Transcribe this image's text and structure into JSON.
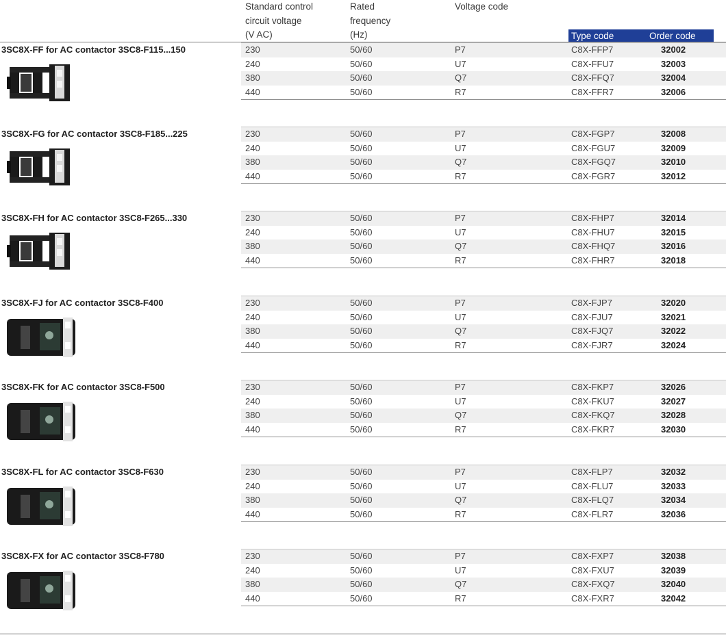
{
  "header": {
    "col_voltage_lines": [
      "Standard control",
      "circuit voltage",
      "(V AC)"
    ],
    "col_frequency_lines": [
      "Rated",
      "frequency",
      "(Hz)"
    ],
    "col_voltage_code": "Voltage code",
    "col_type_code": "Type code",
    "col_order_code": "Order code"
  },
  "colors": {
    "header_band": "#1f3f97",
    "row_shade": "#efefef"
  },
  "groups": [
    {
      "title": "3SC8X-FF for AC contactor 3SC8-F115...150",
      "image_icon": "contactor-coil-small-icon",
      "rows": [
        {
          "voltage": "230",
          "frequency": "50/60",
          "code": "P7",
          "type": "C8X-FFP7",
          "order": "32002"
        },
        {
          "voltage": "240",
          "frequency": "50/60",
          "code": "U7",
          "type": "C8X-FFU7",
          "order": "32003"
        },
        {
          "voltage": "380",
          "frequency": "50/60",
          "code": "Q7",
          "type": "C8X-FFQ7",
          "order": "32004"
        },
        {
          "voltage": "440",
          "frequency": "50/60",
          "code": "R7",
          "type": "C8X-FFR7",
          "order": "32006"
        }
      ]
    },
    {
      "title": "3SC8X-FG for AC contactor 3SC8-F185...225",
      "image_icon": "contactor-coil-small-icon",
      "rows": [
        {
          "voltage": "230",
          "frequency": "50/60",
          "code": "P7",
          "type": "C8X-FGP7",
          "order": "32008"
        },
        {
          "voltage": "240",
          "frequency": "50/60",
          "code": "U7",
          "type": "C8X-FGU7",
          "order": "32009"
        },
        {
          "voltage": "380",
          "frequency": "50/60",
          "code": "Q7",
          "type": "C8X-FGQ7",
          "order": "32010"
        },
        {
          "voltage": "440",
          "frequency": "50/60",
          "code": "R7",
          "type": "C8X-FGR7",
          "order": "32012"
        }
      ]
    },
    {
      "title": "3SC8X-FH for AC contactor 3SC8-F265...330",
      "image_icon": "contactor-coil-small-icon",
      "rows": [
        {
          "voltage": "230",
          "frequency": "50/60",
          "code": "P7",
          "type": "C8X-FHP7",
          "order": "32014"
        },
        {
          "voltage": "240",
          "frequency": "50/60",
          "code": "U7",
          "type": "C8X-FHU7",
          "order": "32015"
        },
        {
          "voltage": "380",
          "frequency": "50/60",
          "code": "Q7",
          "type": "C8X-FHQ7",
          "order": "32016"
        },
        {
          "voltage": "440",
          "frequency": "50/60",
          "code": "R7",
          "type": "C8X-FHR7",
          "order": "32018"
        }
      ]
    },
    {
      "title": "3SC8X-FJ for AC contactor 3SC8-F400",
      "image_icon": "contactor-coil-large-icon",
      "rows": [
        {
          "voltage": "230",
          "frequency": "50/60",
          "code": "P7",
          "type": "C8X-FJP7",
          "order": "32020"
        },
        {
          "voltage": "240",
          "frequency": "50/60",
          "code": "U7",
          "type": "C8X-FJU7",
          "order": "32021"
        },
        {
          "voltage": "380",
          "frequency": "50/60",
          "code": "Q7",
          "type": "C8X-FJQ7",
          "order": "32022"
        },
        {
          "voltage": "440",
          "frequency": "50/60",
          "code": "R7",
          "type": "C8X-FJR7",
          "order": "32024"
        }
      ]
    },
    {
      "title": "3SC8X-FK for AC contactor 3SC8-F500",
      "image_icon": "contactor-coil-large-icon",
      "rows": [
        {
          "voltage": "230",
          "frequency": "50/60",
          "code": "P7",
          "type": "C8X-FKP7",
          "order": "32026"
        },
        {
          "voltage": "240",
          "frequency": "50/60",
          "code": "U7",
          "type": "C8X-FKU7",
          "order": "32027"
        },
        {
          "voltage": "380",
          "frequency": "50/60",
          "code": "Q7",
          "type": "C8X-FKQ7",
          "order": "32028"
        },
        {
          "voltage": "440",
          "frequency": "50/60",
          "code": "R7",
          "type": "C8X-FKR7",
          "order": "32030"
        }
      ]
    },
    {
      "title": "3SC8X-FL for AC contactor 3SC8-F630",
      "image_icon": "contactor-coil-large-icon",
      "rows": [
        {
          "voltage": "230",
          "frequency": "50/60",
          "code": "P7",
          "type": "C8X-FLP7",
          "order": "32032"
        },
        {
          "voltage": "240",
          "frequency": "50/60",
          "code": "U7",
          "type": "C8X-FLU7",
          "order": "32033"
        },
        {
          "voltage": "380",
          "frequency": "50/60",
          "code": "Q7",
          "type": "C8X-FLQ7",
          "order": "32034"
        },
        {
          "voltage": "440",
          "frequency": "50/60",
          "code": "R7",
          "type": "C8X-FLR7",
          "order": "32036"
        }
      ]
    },
    {
      "title": "3SC8X-FX for AC contactor 3SC8-F780",
      "image_icon": "contactor-coil-large-icon",
      "rows": [
        {
          "voltage": "230",
          "frequency": "50/60",
          "code": "P7",
          "type": "C8X-FXP7",
          "order": "32038"
        },
        {
          "voltage": "240",
          "frequency": "50/60",
          "code": "U7",
          "type": "C8X-FXU7",
          "order": "32039"
        },
        {
          "voltage": "380",
          "frequency": "50/60",
          "code": "Q7",
          "type": "C8X-FXQ7",
          "order": "32040"
        },
        {
          "voltage": "440",
          "frequency": "50/60",
          "code": "R7",
          "type": "C8X-FXR7",
          "order": "32042"
        }
      ]
    }
  ]
}
